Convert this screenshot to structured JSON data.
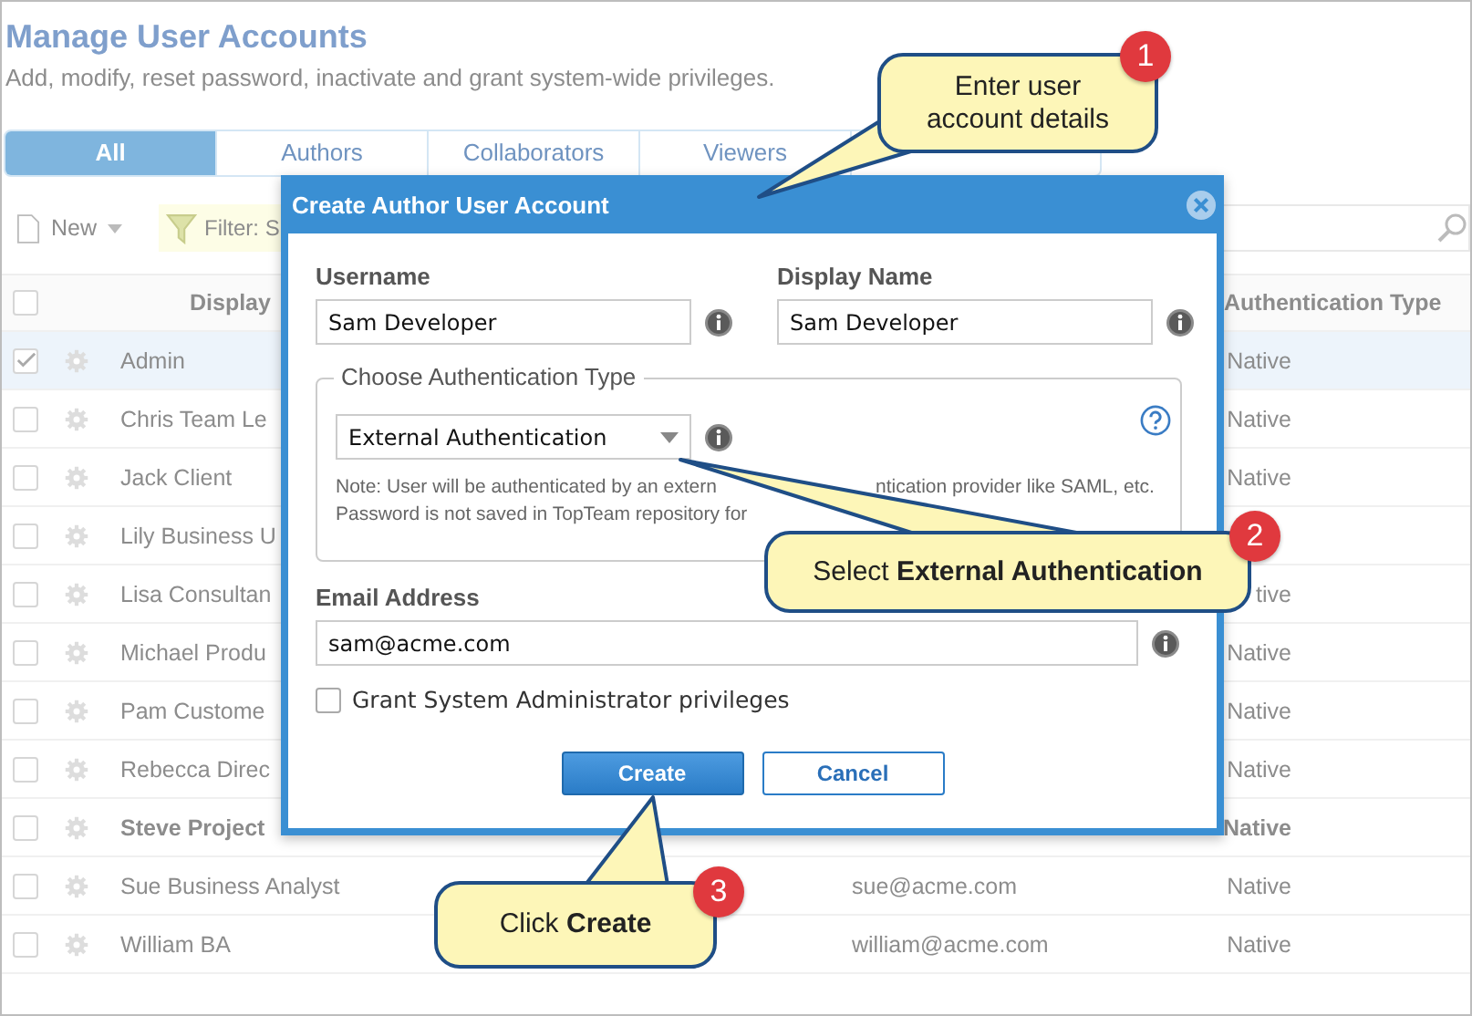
{
  "page": {
    "title": "Manage User Accounts",
    "subtitle": "Add, modify, reset password, inactivate and grant system-wide privileges."
  },
  "tabs": [
    {
      "label": "All",
      "selected": true
    },
    {
      "label": "Authors",
      "selected": false
    },
    {
      "label": "Collaborators",
      "selected": false
    },
    {
      "label": "Viewers",
      "selected": false
    }
  ],
  "toolbar": {
    "new_label": "New",
    "filter_label": "Filter: S"
  },
  "table": {
    "header_checked": false,
    "columns": {
      "display": "Display",
      "auth": "Authentication Type"
    },
    "rows": [
      {
        "checked": true,
        "bold": false,
        "name": "Admin",
        "auth": "Native"
      },
      {
        "checked": false,
        "bold": false,
        "name": "Chris Team Le",
        "auth": "Native"
      },
      {
        "checked": false,
        "bold": false,
        "name": "Jack Client",
        "auth": "Native"
      },
      {
        "checked": false,
        "bold": false,
        "name": "Lily Business U"
      },
      {
        "checked": false,
        "bold": false,
        "name": "Lisa Consultan",
        "auth": "tive"
      },
      {
        "checked": false,
        "bold": false,
        "name": "Michael Produ",
        "auth": "Native"
      },
      {
        "checked": false,
        "bold": false,
        "name": "Pam Custome",
        "auth": "Native"
      },
      {
        "checked": false,
        "bold": false,
        "name": "Rebecca Direc",
        "auth": "Native"
      },
      {
        "checked": false,
        "bold": true,
        "name": "Steve Project",
        "auth": "Native"
      },
      {
        "checked": false,
        "bold": false,
        "name": "Sue Business Analyst",
        "email": "sue@acme.com",
        "auth": "Native"
      },
      {
        "checked": false,
        "bold": false,
        "name": "William BA",
        "email": "william@acme.com",
        "auth": "Native"
      }
    ]
  },
  "dialog": {
    "title": "Create Author User Account",
    "username": {
      "label": "Username",
      "value": "Sam Developer"
    },
    "display_name": {
      "label": "Display Name",
      "value": "Sam Developer"
    },
    "auth": {
      "legend": "Choose Authentication Type",
      "value": "External Authentication",
      "note": [
        [
          "Note: User will be authenticated by an extern",
          "ntication provider like SAML, etc."
        ],
        [
          "Password is not saved in TopTeam repository for"
        ]
      ]
    },
    "email": {
      "label": "Email Address",
      "value": "sam@acme.com"
    },
    "grant": {
      "label": "Grant System Administrator privileges",
      "checked": false
    },
    "buttons": [
      {
        "label": "Create",
        "kind": "primary"
      },
      {
        "label": "Cancel",
        "kind": "secondary"
      }
    ]
  },
  "callouts": [
    {
      "number": "1",
      "text": "Enter user account details"
    },
    {
      "number": "2",
      "text": "Select **External Authentication**"
    },
    {
      "number": "3",
      "text": "Click **Create**"
    }
  ]
}
